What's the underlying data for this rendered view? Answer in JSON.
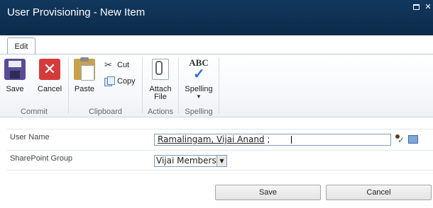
{
  "window": {
    "title": "User Provisioning - New Item"
  },
  "ribbon": {
    "tab_label": "Edit",
    "commit": {
      "group_label": "Commit",
      "save_label": "Save",
      "cancel_label": "Cancel"
    },
    "clipboard": {
      "group_label": "Clipboard",
      "paste_label": "Paste",
      "cut_label": "Cut",
      "copy_label": "Copy"
    },
    "actions": {
      "group_label": "Actions",
      "attach_line1": "Attach",
      "attach_line2": "File"
    },
    "spelling": {
      "group_label": "Spelling",
      "spelling_label": "Spelling",
      "abc_text": "ABC"
    }
  },
  "form": {
    "user_name": {
      "label": "User Name",
      "value": "Ramalingam, Vijai Anand",
      "separator": " ;"
    },
    "sharepoint_group": {
      "label": "SharePoint Group",
      "selected": "Vijai Members"
    },
    "save_button": "Save",
    "cancel_button": "Cancel"
  },
  "icons": {
    "save": "floppy-disk-icon",
    "cancel": "red-x-icon",
    "paste": "clipboard-icon",
    "cut": "scissors-icon",
    "copy": "copy-pages-icon",
    "attach": "paperclip-document-icon",
    "spelling": "abc-check-icon",
    "check_names": "check-names-icon",
    "browse": "address-book-icon"
  },
  "colors": {
    "titlebar": "#12385e",
    "ribbon_bg": "#f5f7fa",
    "field_border": "#7f9db9"
  }
}
